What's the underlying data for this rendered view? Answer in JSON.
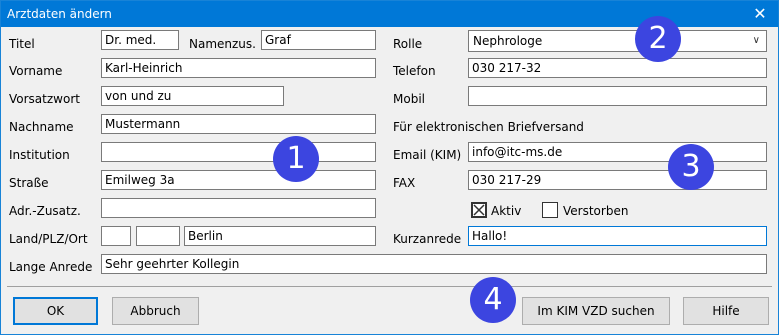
{
  "window": {
    "title": "Arztdaten ändern",
    "close_glyph": "✕"
  },
  "left": {
    "titel": {
      "label": "Titel",
      "value": "Dr. med."
    },
    "namenszus": {
      "label": "Namenzus.",
      "value": "Graf"
    },
    "vorname": {
      "label": "Vorname",
      "value": "Karl-Heinrich"
    },
    "vorsatzwort": {
      "label": "Vorsatzwort",
      "value": "von und zu"
    },
    "nachname": {
      "label": "Nachname",
      "value": "Mustermann"
    },
    "institution": {
      "label": "Institution",
      "value": ""
    },
    "strasse": {
      "label": "Straße",
      "value": "Emilweg 3a"
    },
    "adr_zusatz": {
      "label": "Adr.-Zusatz.",
      "value": ""
    },
    "land_plz_ort": {
      "label": "Land/PLZ/Ort",
      "land": "",
      "plz": "",
      "ort": "Berlin"
    },
    "lange_anrede": {
      "label": "Lange Anrede",
      "value": "Sehr geehrter Kollegin"
    }
  },
  "right": {
    "rolle": {
      "label": "Rolle",
      "value": "Nephrologe"
    },
    "telefon": {
      "label": "Telefon",
      "value": "030 217-32"
    },
    "mobil": {
      "label": "Mobil",
      "value": ""
    },
    "briefversand_heading": "Für elektronischen Briefversand",
    "email": {
      "label": "Email (KIM)",
      "value": "info@itc-ms.de"
    },
    "fax": {
      "label": "FAX",
      "value": "030 217-29"
    },
    "aktiv": {
      "label": "Aktiv",
      "checked": true
    },
    "verstorben": {
      "label": "Verstorben",
      "checked": false
    },
    "kurzanrede": {
      "label": "Kurzanrede",
      "value": "Hallo!"
    }
  },
  "buttons": {
    "ok": "OK",
    "abbruch": "Abbruch",
    "kim": "Im KIM VZD suchen",
    "hilfe": "Hilfe"
  },
  "badges": [
    "1",
    "2",
    "3",
    "4"
  ],
  "colors": {
    "titlebar": "#0078d7",
    "badge": "#3c45e0"
  }
}
